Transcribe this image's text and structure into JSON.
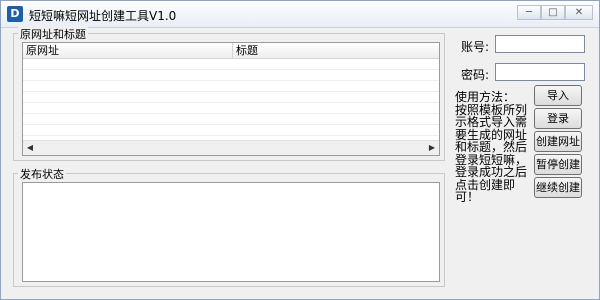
{
  "window": {
    "title": "短短嘛短网址创建工具V1.0",
    "app_icon_letter": "D",
    "minimize_glyph": "─",
    "maximize_glyph": "□",
    "close_glyph": "✕"
  },
  "url_group": {
    "label": "原网址和标题",
    "columns": [
      "原网址",
      "标题"
    ],
    "rows": []
  },
  "status_group": {
    "label": "发布状态",
    "content": ""
  },
  "form": {
    "account_label": "账号:",
    "account_value": "",
    "password_label": "密码:",
    "password_value": ""
  },
  "instructions": "使用方法：　　按照模板所列示格式导入需要生成的网址和标题，然后登录短短嘛，登录成功之后点击创建即可！",
  "buttons": {
    "import": "导入",
    "login": "登录",
    "create": "创建网址",
    "pause": "暂停创建",
    "resume": "继续创建"
  },
  "scroll": {
    "left_arrow": "◀",
    "right_arrow": "▶"
  }
}
